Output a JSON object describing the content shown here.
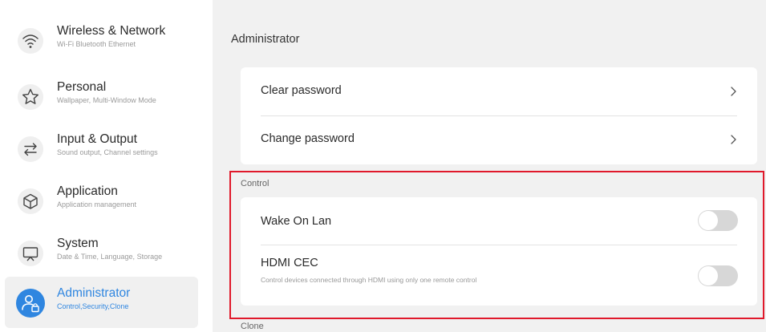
{
  "sidebar": {
    "items": [
      {
        "title": "Wireless & Network",
        "subtitle": "Wi-Fi Bluetooth Ethernet",
        "icon": "wifi-icon",
        "active": false
      },
      {
        "title": "Personal",
        "subtitle": "Wallpaper, Multi-Window Mode",
        "icon": "star-icon",
        "active": false
      },
      {
        "title": "Input & Output",
        "subtitle": "Sound output, Channel settings",
        "icon": "swap-arrows-icon",
        "active": false
      },
      {
        "title": "Application",
        "subtitle": "Application management",
        "icon": "cube-icon",
        "active": false
      },
      {
        "title": "System",
        "subtitle": "Date & Time, Language, Storage",
        "icon": "monitor-icon",
        "active": false
      },
      {
        "title": "Administrator",
        "subtitle": "Control,Security,Clone",
        "icon": "admin-user-lock-icon",
        "active": true
      }
    ]
  },
  "main": {
    "title": "Administrator",
    "password_card": {
      "rows": [
        {
          "label": "Clear password"
        },
        {
          "label": "Change password"
        }
      ]
    },
    "control_section": {
      "label": "Control",
      "rows": [
        {
          "label": "Wake On Lan",
          "enabled": false
        },
        {
          "label": "HDMI CEC",
          "description": "Control devices connected through HDMI using only one remote control",
          "enabled": false
        }
      ]
    },
    "clone_section": {
      "label": "Clone"
    }
  },
  "colors": {
    "accent": "#2f86e0",
    "highlight_border": "#e0192b",
    "toggle_off": "#d7d7d7",
    "background": "#f1f1f1"
  }
}
